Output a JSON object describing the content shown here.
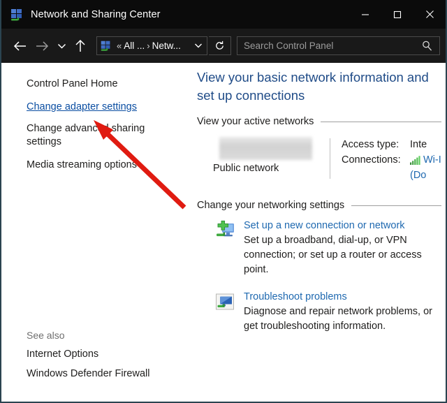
{
  "window": {
    "title": "Network and Sharing Center",
    "icon": "network-sharing-icon",
    "controls": {
      "minimize": "—",
      "maximize": "□",
      "close": "✕"
    }
  },
  "navbar": {
    "back": "back-arrow",
    "forward": "forward-arrow",
    "recent": "recent-locations-chevron",
    "up": "up-arrow",
    "address": {
      "icon": "network-sharing-icon",
      "leading_separator": "«",
      "crumb1": "All ...",
      "crumb_separator": "›",
      "crumb2": "Netw...",
      "dropdown": "address-dropdown-chevron"
    },
    "refresh": "refresh-icon",
    "search": {
      "placeholder": "Search Control Panel",
      "value": "",
      "icon": "search-icon"
    }
  },
  "sidebar": {
    "items": [
      {
        "label": "Control Panel Home",
        "style": "plain"
      },
      {
        "label": "Change adapter settings",
        "style": "link"
      },
      {
        "label": "Change advanced sharing settings",
        "style": "plain"
      },
      {
        "label": "Media streaming options",
        "style": "plain"
      }
    ],
    "see_also": {
      "label": "See also",
      "items": [
        {
          "label": "Internet Options"
        },
        {
          "label": "Windows Defender Firewall"
        }
      ]
    }
  },
  "main": {
    "heading": "View your basic network information and set up connections",
    "active_networks": {
      "section_title": "View your active networks",
      "network_name": "",
      "network_name_redacted": true,
      "network_type": "Public network",
      "access_type_label": "Access type:",
      "access_type_value": "Inte",
      "connections_label": "Connections:",
      "connections_value": "Wi-I",
      "connections_icon": "wifi-signal-icon",
      "connections_detail": "(Do"
    },
    "networking_settings": {
      "section_title": "Change your networking settings",
      "tasks": [
        {
          "icon": "new-connection-icon",
          "title": "Set up a new connection or network",
          "description": "Set up a broadband, dial-up, or VPN connection; or set up a router or access point."
        },
        {
          "icon": "troubleshoot-icon",
          "title": "Troubleshoot problems",
          "description": "Diagnose and repair network problems, or get troubleshooting information."
        }
      ]
    }
  },
  "annotation": {
    "arrow_color": "#e01b11",
    "points_to": "Change adapter settings"
  }
}
